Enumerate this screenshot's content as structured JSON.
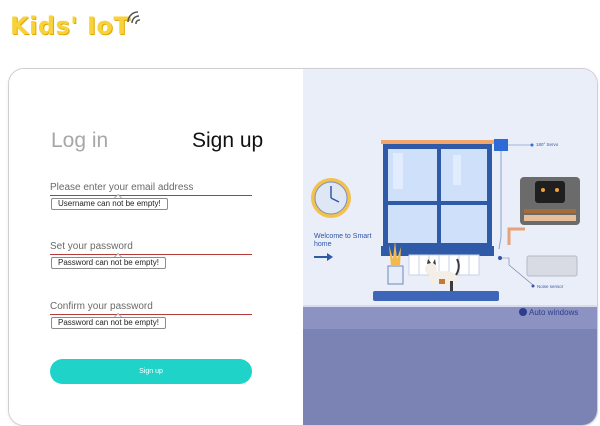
{
  "app": {
    "logo_text": "Kids' IoT"
  },
  "tabs": {
    "login": "Log in",
    "signup": "Sign up"
  },
  "form": {
    "email": {
      "label": "Please enter your email address",
      "error": "Username can not be empty!"
    },
    "password": {
      "label": "Set your password",
      "error": "Password can not be empty!"
    },
    "confirm": {
      "label": "Confirm your password",
      "error": "Password can not be empty!"
    },
    "submit_label": "Sign up"
  },
  "illustration": {
    "welcome_text": "Welcome to Smart home",
    "servo_label": "180° Servo",
    "noise_label": "Noise sensor",
    "auto_windows_label": "Auto windows"
  },
  "colors": {
    "logo": "#f7d23a",
    "accent_button": "#1fd3c9",
    "field_underline": "#b73a3a",
    "illustration_bg": "#e9eef8",
    "illustration_floor": "#7b82b4",
    "window_frame": "#2f5aa8"
  },
  "icons": {
    "logo_signal": "wifi-icon",
    "clock": "clock-icon",
    "arrow": "arrow-right-icon",
    "cat": "cat-icon",
    "microbit": "microbit-board-icon"
  }
}
